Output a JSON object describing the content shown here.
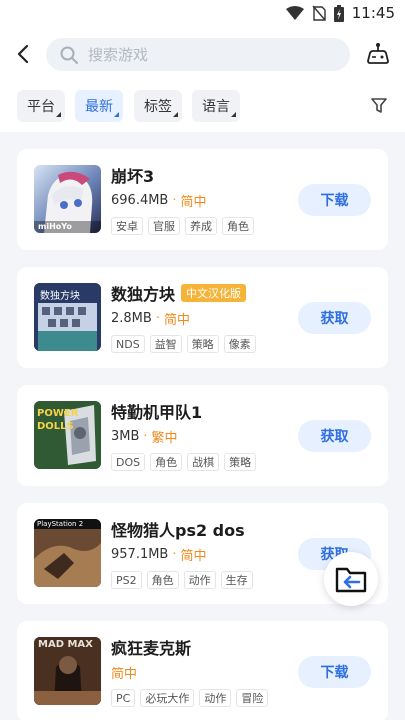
{
  "status": {
    "time": "11:45"
  },
  "search": {
    "placeholder": "搜索游戏"
  },
  "filters": [
    "平台",
    "最新",
    "标签",
    "语言"
  ],
  "games": [
    {
      "title": "崩坏3",
      "size": "696.4MB",
      "lang": "简中",
      "badge": "",
      "tags": [
        "安卓",
        "官服",
        "养成",
        "角色"
      ],
      "action": "下载",
      "thumb_text": "miHoYo"
    },
    {
      "title": "数独方块",
      "size": "2.8MB",
      "lang": "简中",
      "badge": "中文汉化版",
      "tags": [
        "NDS",
        "益智",
        "策略",
        "像素"
      ],
      "action": "获取",
      "thumb_text": "数独方块"
    },
    {
      "title": "特勤机甲队1",
      "size": "3MB",
      "lang": "繁中",
      "badge": "",
      "tags": [
        "DOS",
        "角色",
        "战棋",
        "策略"
      ],
      "action": "获取",
      "thumb_text": "POWER DOLLS"
    },
    {
      "title": "怪物猎人ps2 dos",
      "size": "957.1MB",
      "lang": "简中",
      "badge": "",
      "tags": [
        "PS2",
        "角色",
        "动作",
        "生存"
      ],
      "action": "获取",
      "thumb_text": "PlayStation 2"
    },
    {
      "title": "疯狂麦克斯",
      "size": "",
      "lang": "简中",
      "badge": "",
      "tags": [
        "PC",
        "必玩大作",
        "动作",
        "冒险"
      ],
      "action": "下载",
      "thumb_text": "MAD MAX"
    }
  ],
  "colors": {
    "accent": "#2f6fe0",
    "lang": "#f08a1c",
    "badge": "#f5b437"
  }
}
